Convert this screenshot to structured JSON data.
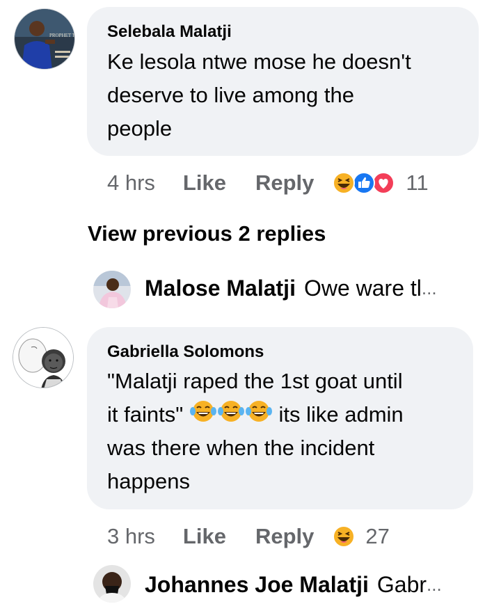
{
  "comments": [
    {
      "author": "Selebala Malatji",
      "avatar_overlay": "PROPHET TB JOSHUA",
      "text_lines": [
        "Ke lesola ntwe mose he doesn't",
        "deserve to live among the",
        "people"
      ],
      "time": "4 hrs",
      "like_label": "Like",
      "reply_label": "Reply",
      "reaction_icons": [
        "haha-icon",
        "like-icon",
        "love-icon"
      ],
      "reaction_count": "11"
    },
    {
      "author": "Gabriella Solomons",
      "text_line1": "\"Malatji raped the 1st goat until",
      "text_line2_before": "it faints\"",
      "text_line2_after": " its like admin",
      "text_lines_rest": [
        "was there when the incident",
        "happens"
      ],
      "inline_emojis": [
        "crying-laughing-icon",
        "crying-laughing-icon",
        "crying-laughing-icon"
      ],
      "time": "3 hrs",
      "like_label": "Like",
      "reply_label": "Reply",
      "reaction_icons": [
        "haha-icon"
      ],
      "reaction_count": "27"
    }
  ],
  "view_previous_label": "View previous 2 replies",
  "replies": [
    {
      "author": "Malose Malatji",
      "preview": "Owe ware tl",
      "ellipsis": "..."
    },
    {
      "author": "Johannes Joe Malatji",
      "preview": "Gabr",
      "ellipsis": "..."
    }
  ],
  "colors": {
    "bubble_bg": "#f0f2f5",
    "meta_text": "#65676b",
    "like_blue": "#1877f2",
    "love_red": "#f33e58",
    "haha_yellow": "#f7b125"
  }
}
